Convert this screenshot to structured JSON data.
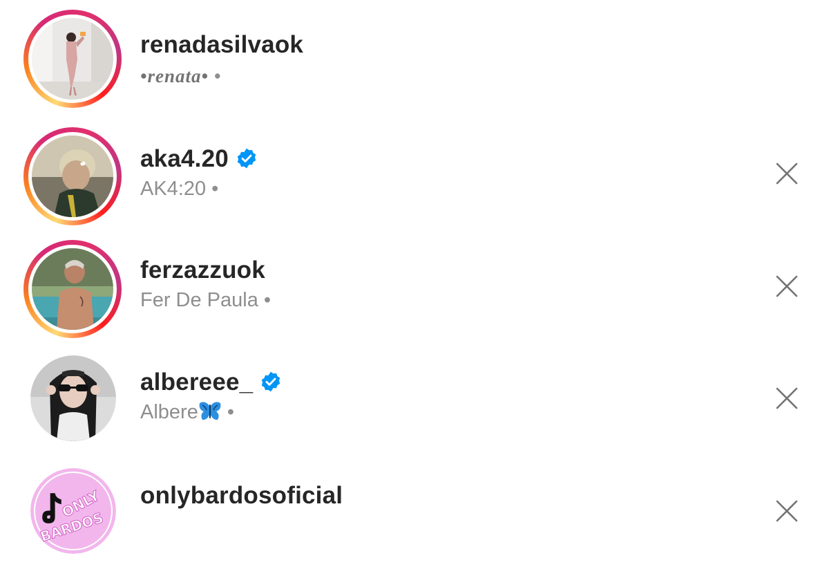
{
  "suggestions": [
    {
      "username": "renadasilvaok",
      "display_name": "•renata•",
      "has_story_ring": true,
      "verified": false,
      "dismissible": false,
      "avatar_icon": "person-photo"
    },
    {
      "username": "aka4.20",
      "display_name": "AK4:20",
      "has_story_ring": true,
      "verified": true,
      "dismissible": true,
      "avatar_icon": "person-photo"
    },
    {
      "username": "ferzazzuok",
      "display_name": "Fer De Paula",
      "has_story_ring": true,
      "verified": false,
      "dismissible": true,
      "avatar_icon": "person-photo"
    },
    {
      "username": "albereee_",
      "display_name": "Albere",
      "display_emoji": "butterfly-icon",
      "has_story_ring": false,
      "verified": true,
      "dismissible": true,
      "avatar_icon": "person-photo"
    },
    {
      "username": "onlybardosoficial",
      "display_name": "",
      "has_story_ring": false,
      "verified": false,
      "dismissible": true,
      "avatar_icon": "only-bardos-logo"
    }
  ],
  "separator": "•",
  "colors": {
    "text_primary": "#262626",
    "text_secondary": "#8e8e8e",
    "verified_blue": "#0095f6",
    "background": "#ffffff"
  }
}
